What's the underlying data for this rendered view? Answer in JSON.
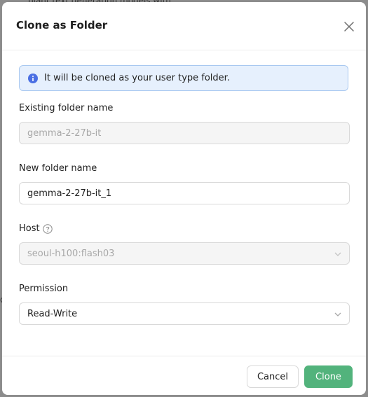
{
  "background": {
    "snippet_top": "plant text generation models with",
    "snippet_left": "o"
  },
  "dialog": {
    "title": "Clone as Folder",
    "info_text": "It will be cloned as your user type folder.",
    "existing_label": "Existing folder name",
    "existing_value": "gemma-2-27b-it",
    "new_label": "New folder name",
    "new_value": "gemma-2-27b-it_1",
    "host_label": "Host",
    "host_value": "seoul-h100:flash03",
    "permission_label": "Permission",
    "permission_value": "Read-Write",
    "cancel_label": "Cancel",
    "clone_label": "Clone"
  },
  "colors": {
    "accent": "#52b37c",
    "info_bg": "#e6f0fd",
    "info_icon": "#4a6fe3"
  }
}
